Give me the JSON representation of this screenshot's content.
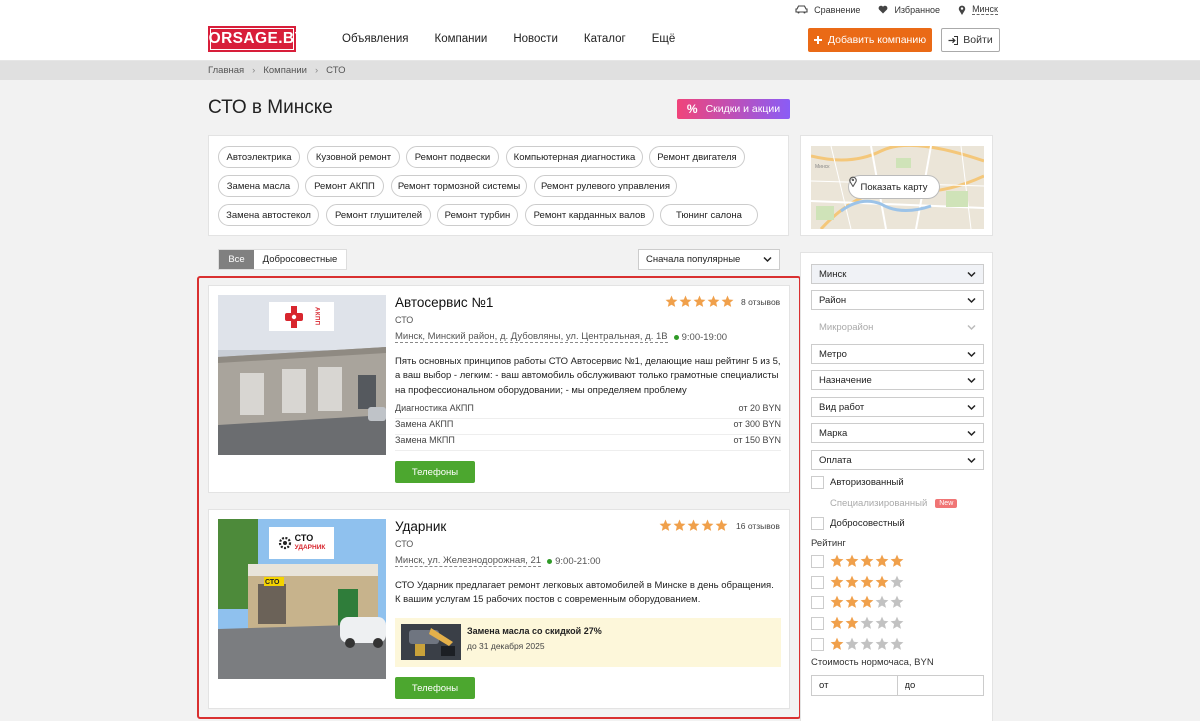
{
  "topbar": {
    "compare": "Сравнение",
    "favorites": "Избранное",
    "city": "Минск"
  },
  "header": {
    "logo": "FORSAGE.BY",
    "nav": [
      "Объявления",
      "Компании",
      "Новости",
      "Каталог",
      "Ещё"
    ],
    "add_company": "Добавить компанию",
    "login": "Войти"
  },
  "breadcrumbs": [
    "Главная",
    "Компании",
    "СТО"
  ],
  "page": {
    "title": "СТО в Минске",
    "discounts_button": "Скидки и акции"
  },
  "categories": [
    "Автоэлектрика",
    "Кузовной ремонт",
    "Ремонт подвески",
    "Компьютерная диагностика",
    "Ремонт двигателя",
    "Замена масла",
    "Ремонт АКПП",
    "Ремонт тормозной системы",
    "Ремонт рулевого управления",
    "Замена автостекол",
    "Ремонт глушителей",
    "Ремонт турбин",
    "Ремонт карданных валов",
    "Тюнинг салона"
  ],
  "map": {
    "button": "Показать карту"
  },
  "tabs": [
    "Все",
    "Добросовестные"
  ],
  "sort": {
    "selected": "Сначала популярные"
  },
  "listings": [
    {
      "name": "Автосервис №1",
      "type": "СТО",
      "address": "Минск, Минский район, д. Дубовляны, ул. Центральная, д. 1В",
      "hours": "9:00-19:00",
      "rating": 5,
      "reviews": "8 отзывов",
      "logo_text": "АКПП",
      "description": "Пять основных принципов работы СТО Автосервис №1, делающие наш рейтинг 5 из 5, а ваш выбор - легким: - ваш автомобиль обслуживают только грамотные специалисты на профессиональном оборудовании; - мы определяем проблему",
      "prices": [
        {
          "service": "Диагностика АКПП",
          "price": "от 20 BYN"
        },
        {
          "service": "Замена АКПП",
          "price": "от 300 BYN"
        },
        {
          "service": "Замена МКПП",
          "price": "от 150 BYN"
        }
      ],
      "phones_button": "Телефоны"
    },
    {
      "name": "Ударник",
      "type": "СТО",
      "address": "Минск, ул. Железнодорожная, 21",
      "hours": "9:00-21:00",
      "rating": 5,
      "reviews": "16 отзывов",
      "logo_text": "СТО",
      "logo_subtext": "УДАРНИК",
      "sign_text": "СТО",
      "description": "СТО Ударник предлагает ремонт легковых автомобилей в Минске в день обращения. К вашим услугам 15 рабочих постов с современным оборудованием.",
      "promo": {
        "title": "Замена масла со скидкой 27%",
        "date": "до 31 декабря 2025"
      },
      "phones_button": "Телефоны"
    }
  ],
  "filters": {
    "selects": [
      "Минск",
      "Район",
      "Микрорайон",
      "Метро",
      "Назначение",
      "Вид работ",
      "Марка",
      "Оплата"
    ],
    "checkboxes": [
      {
        "label": "Авторизованный"
      },
      {
        "label": "Специализированный",
        "badge": "New"
      },
      {
        "label": "Добросовестный"
      }
    ],
    "rating_label": "Рейтинг",
    "rating_options": [
      5,
      4,
      3,
      2,
      1
    ],
    "price_label": "Стоимость нормочаса, BYN",
    "price_from": "от",
    "price_to": "до"
  },
  "colors": {
    "accent_orange": "#ea6a16",
    "brand_red": "#d81e3a",
    "green": "#4ca72f",
    "star": "#f0a04b",
    "highlight": "#d93030"
  }
}
